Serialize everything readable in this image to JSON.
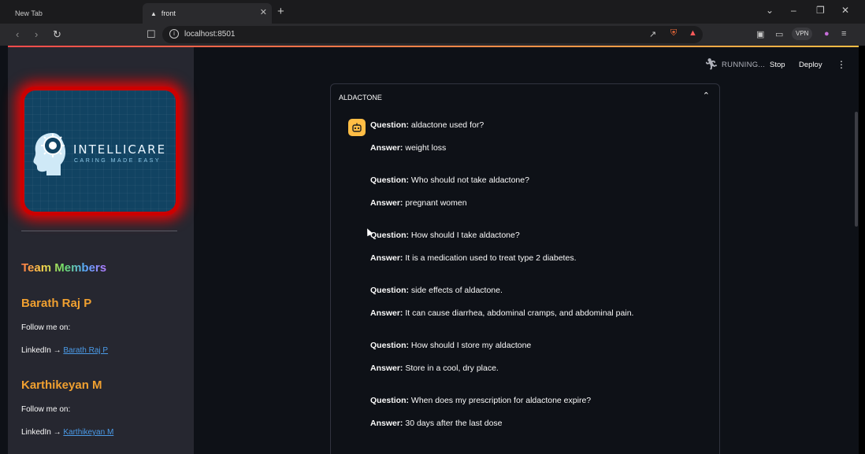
{
  "browser": {
    "tabs": [
      {
        "label": "New Tab"
      },
      {
        "label": "front"
      }
    ],
    "url": "localhost:8501",
    "vpn_label": "VPN"
  },
  "sidebar": {
    "logo_title": "INTELLICARE",
    "logo_subtitle": "CARING MADE EASY",
    "team_title": "Team Members",
    "members": [
      {
        "name": "Barath Raj P",
        "follow": "Follow me on:",
        "linkedin_prefix": "LinkedIn → ",
        "link_text": "Barath Raj P"
      },
      {
        "name": "Karthikeyan M",
        "follow": "Follow me on:",
        "linkedin_prefix": "LinkedIn → ",
        "link_text": "Karthikeyan M"
      }
    ]
  },
  "header": {
    "status": "RUNNING...",
    "stop": "Stop",
    "deploy": "Deploy"
  },
  "expander": {
    "title": "ALDACTONE",
    "question_label": "Question:",
    "answer_label": "Answer:",
    "items": [
      {
        "q": "aldactone used for?",
        "a": "weight loss"
      },
      {
        "q": "Who should not take aldactone?",
        "a": "pregnant women"
      },
      {
        "q": "How should I take aldactone?",
        "a": "It is a medication used to treat type 2 diabetes."
      },
      {
        "q": "side effects of aldactone.",
        "a": "It can cause diarrhea, abdominal cramps, and abdominal pain."
      },
      {
        "q": "How should I store my aldactone",
        "a": "Store in a cool, dry place."
      },
      {
        "q": "When does my prescription for aldactone expire?",
        "a": "30 days after the last dose"
      }
    ]
  },
  "colors": {
    "accent": "#ff4b4b",
    "member_name": "#f0a030",
    "link": "#4b9be8",
    "avatar": "#ffbd45",
    "app_background": "#0e1117",
    "sidebar_background": "#262730"
  }
}
